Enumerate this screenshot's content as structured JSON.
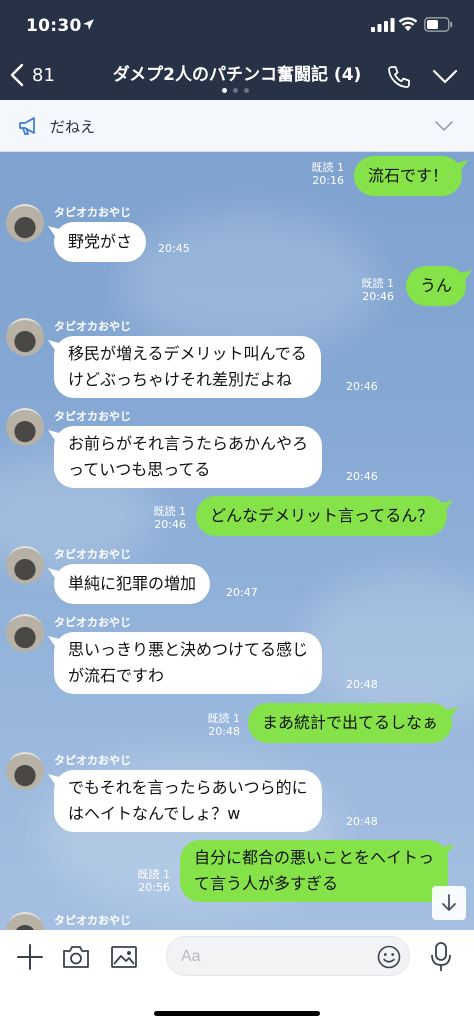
{
  "status_bar": {
    "time": "10:30"
  },
  "header": {
    "back_count": "81",
    "title": "ダメプ2人のパチンコ奮闘記 (4)"
  },
  "announcement": {
    "text": "だねえ"
  },
  "messages": [
    {
      "side": "out",
      "text": "流石です！",
      "read": "既読 1",
      "time": "20:16"
    },
    {
      "side": "in",
      "sender": "タピオカおやじ",
      "text": "野党がさ",
      "time": "20:45"
    },
    {
      "side": "out",
      "text": "うん",
      "read": "既読 1",
      "time": "20:46"
    },
    {
      "side": "in",
      "sender": "タピオカおやじ",
      "lines": [
        "移民が増えるデメリット叫んでる",
        "けどぶっちゃけそれ差別だよね"
      ],
      "time": "20:46"
    },
    {
      "side": "in",
      "sender": "タピオカおやじ",
      "lines": [
        "お前らがそれ言うたらあかんやろ",
        "っていつも思ってる"
      ],
      "time": "20:46"
    },
    {
      "side": "out",
      "text": "どんなデメリット言ってるん？",
      "read": "既読 1",
      "time": "20:46"
    },
    {
      "side": "in",
      "sender": "タピオカおやじ",
      "text": "単純に犯罪の増加",
      "time": "20:47"
    },
    {
      "side": "in",
      "sender": "タピオカおやじ",
      "lines": [
        "思いっきり悪と決めつけてる感じ",
        "が流石ですわ"
      ],
      "time": "20:48"
    },
    {
      "side": "out",
      "text": "まあ統計で出てるしなぁ",
      "read": "既読 1",
      "time": "20:48"
    },
    {
      "side": "in",
      "sender": "タピオカおやじ",
      "lines": [
        "でもそれを言ったらあいつら的に",
        "はヘイトなんでしょ？w"
      ],
      "time": "20:48"
    },
    {
      "side": "out",
      "lines": [
        "自分に都合の悪いことをヘイトっ",
        "て言う人が多すぎる"
      ],
      "read": "既読 1",
      "time": "20:56"
    },
    {
      "side": "in",
      "sender": "タピオカおやじ"
    }
  ],
  "input": {
    "placeholder": "Aa"
  },
  "icons": {
    "back": "chevron-left-icon",
    "call": "phone-icon",
    "collapse": "chevron-down-icon",
    "announcement": "megaphone-icon",
    "add": "plus-icon",
    "camera": "camera-icon",
    "image": "image-icon",
    "emoji": "emoji-icon",
    "mic": "microphone-icon",
    "scroll": "arrow-down-icon"
  },
  "colors": {
    "header_bg": "#273246",
    "chat_bg": "#84a7d3",
    "bubble_out": "#85e249",
    "bubble_in": "#ffffff"
  }
}
